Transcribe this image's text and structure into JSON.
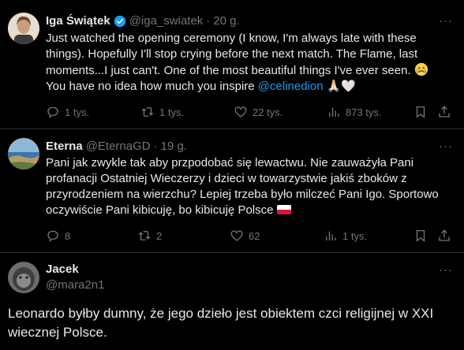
{
  "tweets": [
    {
      "name": "Iga Świątek",
      "handle": "@iga_swiatek",
      "sep": "·",
      "time": "20 g.",
      "verified": true,
      "text_main": "Just watched the opening ceremony (I know, I'm always late with these things). Hopefully I'll stop crying before the next match. The Flame, last moments...I just can't. One of the most beautiful things I've ever seen.",
      "text_second": "You have no idea how much you inspire ",
      "mention": "@celinedion",
      "emoji_end": "🙏🏻🤍",
      "replies": "1 tys.",
      "retweets": "1 tys.",
      "likes": "22 tys.",
      "views": "873 tys."
    },
    {
      "name": "Eterna",
      "handle": "@EternaGD",
      "sep": "·",
      "time": "19 g.",
      "text": "Pani jak zwykle tak aby przpodobać się lewactwu. Nie zauważyła Pani profanacji Ostatniej Wieczerzy i dzieci w towarzystwie jakiś zboków z przyrodzeniem na wierzchu? Lepiej trzeba było milczeć Pani Igo. Sportowo oczywiście Pani kibicuję, bo kibicuję Polsce",
      "replies": "8",
      "retweets": "2",
      "likes": "62",
      "views": "1 tys."
    },
    {
      "name": "Jacek",
      "handle": "@mara2n1",
      "text": "Leonardo byłby dumny, że jego dzieło jest obiektem czci religijnej w XXI wiecznej Polsce."
    }
  ],
  "more_label": "···",
  "colors": {
    "accent": "#1d9bf0",
    "muted": "#71767b",
    "background": "#000000"
  }
}
